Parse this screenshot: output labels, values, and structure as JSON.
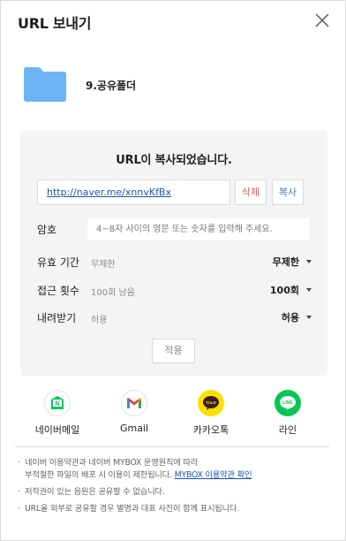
{
  "dialog": {
    "title": "URL 보내기"
  },
  "folder": {
    "name": "9.공유폴더"
  },
  "panel": {
    "copied_message": "URL이 복사되었습니다.",
    "url": "http://naver.me/xnnvKfBx",
    "delete_label": "삭제",
    "copy_label": "복사",
    "password": {
      "label": "암호",
      "placeholder": "4~8자 사이의 영문 또는 숫자를 입력해 주세요."
    },
    "expiry": {
      "label": "유효 기간",
      "current": "무제한",
      "selected": "무제한"
    },
    "access_count": {
      "label": "접근 횟수",
      "current": "100회 남음",
      "selected": "100회"
    },
    "download": {
      "label": "내려받기",
      "current": "허용",
      "selected": "허용"
    },
    "apply_label": "적용"
  },
  "share": {
    "items": [
      {
        "label": "네이버메일",
        "icon": "naver-mail-icon"
      },
      {
        "label": "Gmail",
        "icon": "gmail-icon"
      },
      {
        "label": "카카오톡",
        "icon": "kakaotalk-icon"
      },
      {
        "label": "라인",
        "icon": "line-icon"
      }
    ]
  },
  "notes": {
    "note1_line1": "네이버 이용약관과 네이버 MYBOX 운영원칙에 따라",
    "note1_line2": "부적절한 파일의 배포 시 이용이 제한됩니다.",
    "terms_link": "MYBOX 이용약관 확인",
    "note2": "저작권이 있는 음원은 공유할 수 없습니다.",
    "note3": "URL을 외부로 공유할 경우 별명과 대표 사진이 함께 표시됩니다."
  },
  "colors": {
    "folder": "#6cb4f5",
    "link": "#1a56b5",
    "delete": "#e0554f",
    "copy": "#4a76c4",
    "panel_bg": "#f3f4f6",
    "naver_green": "#03c75a",
    "kakao_yellow": "#fae100",
    "line_green": "#06c755"
  }
}
